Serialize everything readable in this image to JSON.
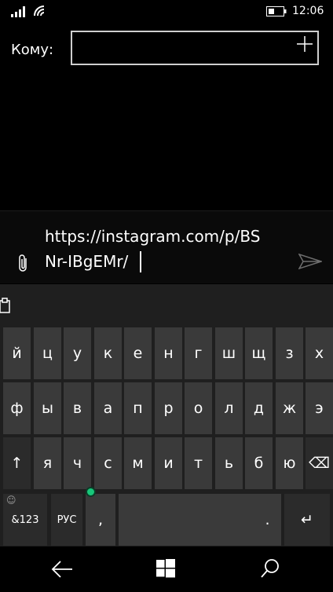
{
  "status_bar": {
    "time": "12:06",
    "icons": [
      "signal-icon",
      "wifi-icon",
      "battery-icon"
    ]
  },
  "recipient": {
    "label": "Кому:",
    "value": "",
    "add_icon": "plus-icon"
  },
  "message": {
    "line1": "https://instagram.com/p/BS",
    "line2": "Nr-IBgEMr/",
    "attach_icon": "paperclip-icon",
    "send_icon": "send-icon"
  },
  "keyboard": {
    "row1": [
      "й",
      "ц",
      "у",
      "к",
      "е",
      "н",
      "г",
      "ш",
      "щ",
      "з",
      "х"
    ],
    "row2": [
      "ф",
      "ы",
      "в",
      "а",
      "п",
      "р",
      "о",
      "л",
      "д",
      "ж",
      "э"
    ],
    "row3": [
      "↑",
      "я",
      "ч",
      "с",
      "м",
      "и",
      "т",
      "ь",
      "б",
      "ю",
      "⌫"
    ],
    "row4": {
      "symbols": "&123",
      "language": "РУС",
      "comma": ",",
      "space": "",
      "period": ".",
      "enter": "↵"
    },
    "emoji_glyph": "☺",
    "cursor_dot_color": "#18c77a"
  },
  "navigation": {
    "back_icon": "back-arrow-icon",
    "home_icon": "windows-logo-icon",
    "search_icon": "search-icon"
  }
}
